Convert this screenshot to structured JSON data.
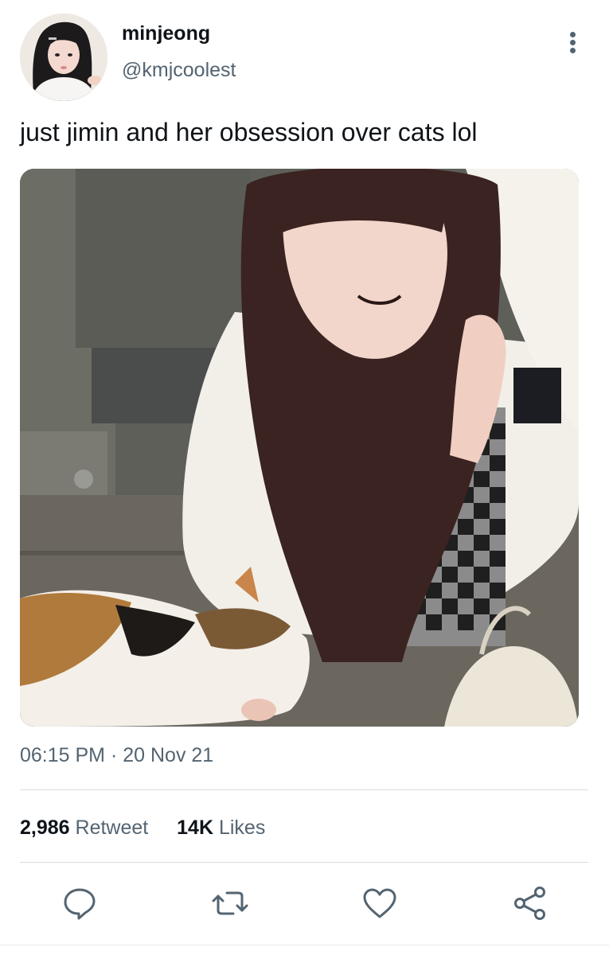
{
  "tweet": {
    "display_name": "minjeong",
    "handle": "@kmjcoolest",
    "text": "just jimin and her obsession over cats lol",
    "time": "06:15 PM",
    "date_separator": "·",
    "date": "20 Nov 21"
  },
  "stats": {
    "retweets_count": "2,986",
    "retweets_label": "Retweet",
    "likes_count": "14K",
    "likes_label": "Likes"
  },
  "actions": {
    "icons": [
      "reply-icon",
      "retweet-icon",
      "like-icon",
      "share-icon"
    ],
    "icon_color": "#536471"
  },
  "colors": {
    "text_primary": "#0f1419",
    "text_secondary": "#536471",
    "divider": "#d8dde1"
  }
}
